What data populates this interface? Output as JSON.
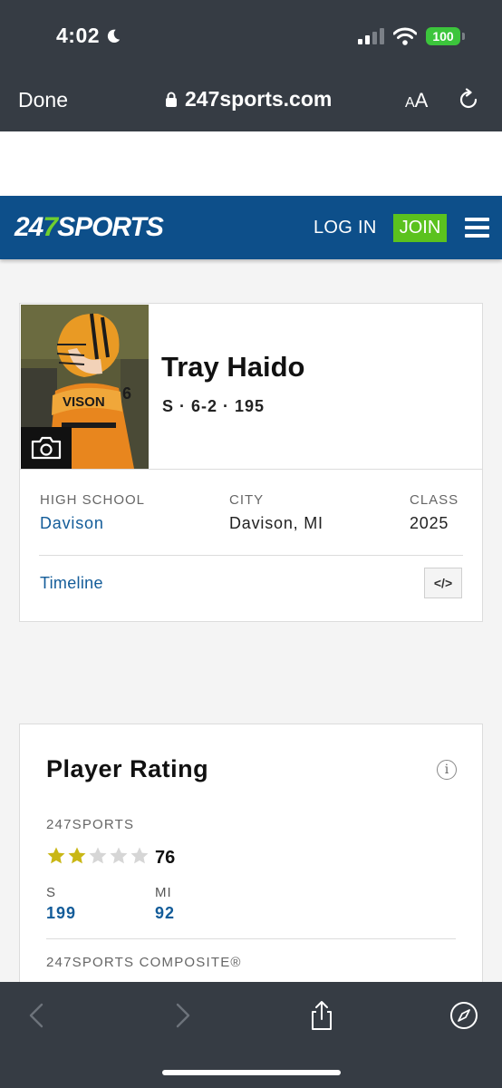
{
  "status_bar": {
    "time": "4:02",
    "battery": "100"
  },
  "browser": {
    "done_label": "Done",
    "url": "247sports.com",
    "aa_small": "A",
    "aa_large": "A"
  },
  "site_nav": {
    "logo_left": "24",
    "logo_seven": "7",
    "logo_right": "SPORTS",
    "login_label": "LOG IN",
    "join_label": "JOIN"
  },
  "player": {
    "name": "Tray Haido",
    "meta": "S · 6-2 · 195",
    "high_school_label": "HIGH SCHOOL",
    "high_school": "Davison",
    "city_label": "CITY",
    "city": "Davison, MI",
    "class_label": "CLASS",
    "class": "2025",
    "timeline_label": "Timeline",
    "embed_icon_text": "</>"
  },
  "rating": {
    "title": "Player Rating",
    "info_icon": "i",
    "source_label": "247SPORTS",
    "stars_filled": 2,
    "stars_total": 5,
    "score": "76",
    "position_label": "S",
    "position_rank": "199",
    "state_label": "MI",
    "state_rank": "92",
    "composite_label": "247SPORTS COMPOSITE®"
  },
  "colors": {
    "header_blue": "#0d4f8a",
    "join_green": "#5bc21e",
    "link_blue": "#135c99",
    "star_gold": "#c9b715",
    "star_gray": "#d6d6d6"
  }
}
